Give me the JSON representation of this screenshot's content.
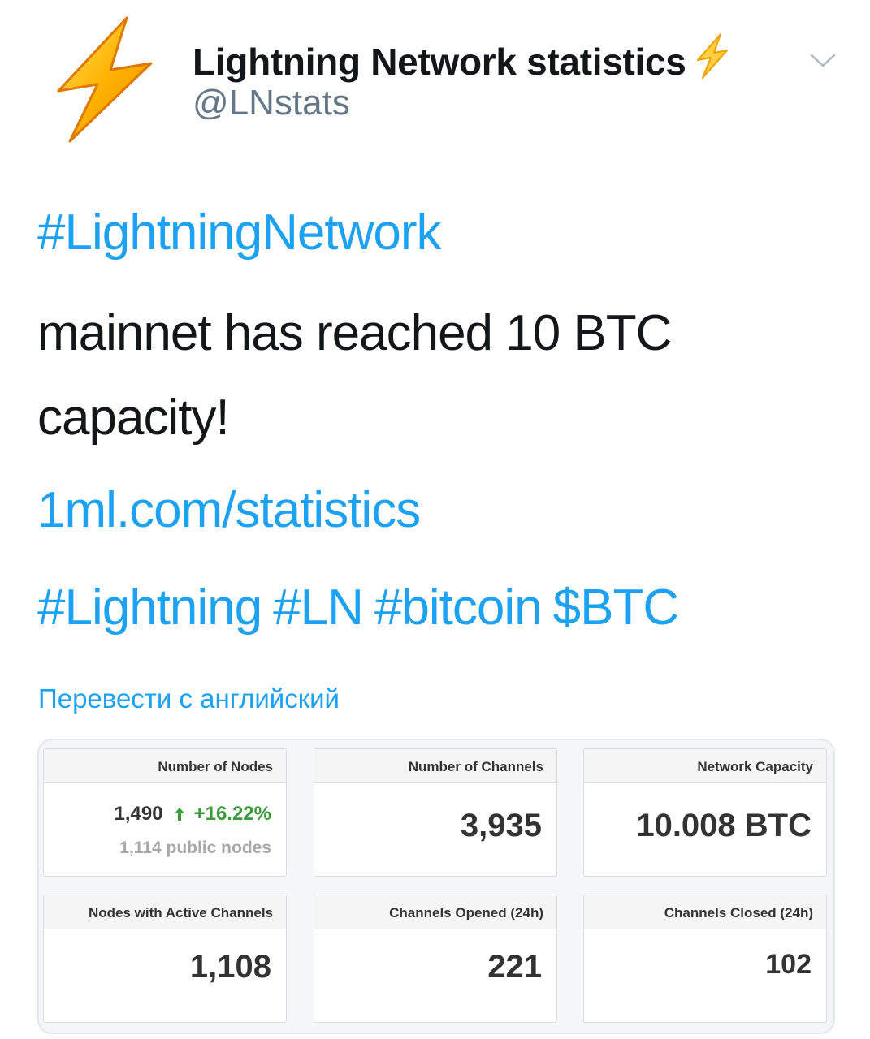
{
  "account": {
    "display_name": "Lightning Network statistics",
    "handle": "@LNstats"
  },
  "tweet": {
    "hashtag_main": "#LightningNetwork",
    "text_line1": "mainnet has reached 10 BTC",
    "text_line2": "capacity!",
    "link": "1ml.com/statistics",
    "tags": [
      "#Lightning",
      "#LN",
      "#bitcoin",
      "$BTC"
    ]
  },
  "translate_label": "Перевести с английский",
  "stats": {
    "nodes": {
      "label": "Number of Nodes",
      "value": "1,490",
      "change": "+16.22%",
      "sub": "1,114 public nodes"
    },
    "channels": {
      "label": "Number of Channels",
      "value": "3,935"
    },
    "capacity": {
      "label": "Network Capacity",
      "value": "10.008 BTC"
    },
    "active_nodes": {
      "label": "Nodes with Active Channels",
      "value": "1,108"
    },
    "opened": {
      "label": "Channels Opened (24h)",
      "value": "221"
    },
    "closed": {
      "label": "Channels Closed (24h)",
      "value": "102"
    }
  },
  "colors": {
    "link": "#1da1f2",
    "bolt": "#ffb300",
    "positive": "#3c9a3c"
  },
  "icons": [
    "lightning-bolt-icon",
    "chevron-down-icon",
    "up-arrow-icon"
  ]
}
